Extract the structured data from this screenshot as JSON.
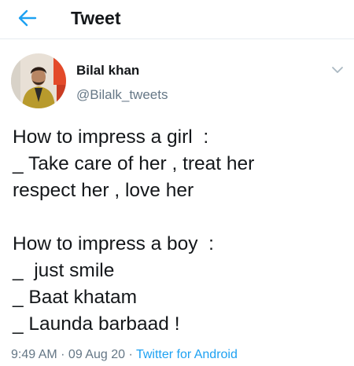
{
  "header": {
    "title": "Tweet",
    "back_icon": "back-arrow-icon",
    "accent": "#1da1f2"
  },
  "tweet": {
    "author": {
      "name": "Bilal khan",
      "handle": "@Bilalk_tweets"
    },
    "lines": [
      "How to impress a girl  :",
      "_ Take care of her , treat her",
      "respect her , love her",
      "",
      "How to impress a boy  :",
      "_  just smile",
      "_ Baat khatam",
      "_ Launda barbaad !"
    ],
    "time": "9:49 AM",
    "sep1": " · ",
    "date": "09 Aug 20",
    "sep2": " · ",
    "source": "Twitter for Android"
  },
  "colors": {
    "text": "#14171a",
    "secondary": "#657786",
    "link": "#1da1f2"
  }
}
